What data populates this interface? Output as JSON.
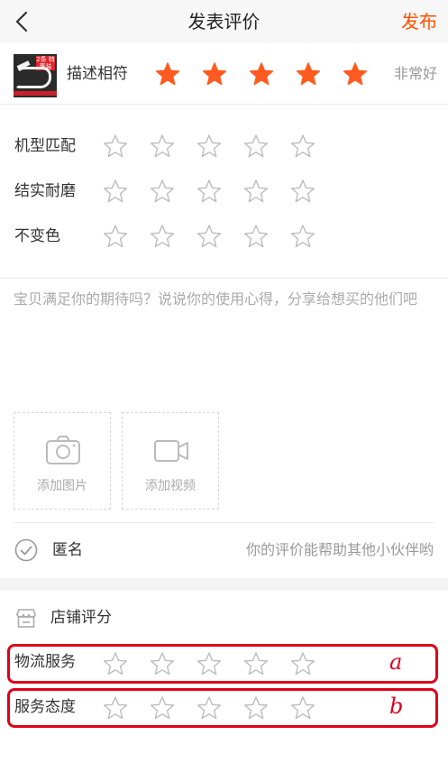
{
  "header": {
    "title": "发表评价",
    "publish_label": "发布"
  },
  "product": {
    "thumb_badge": "2条 特惠装",
    "description_label": "描述相符",
    "description_rating": 5,
    "rating_text": "非常好"
  },
  "aspect_ratings": [
    {
      "label": "机型匹配",
      "rating": 0
    },
    {
      "label": "结实耐磨",
      "rating": 0
    },
    {
      "label": "不变色",
      "rating": 0
    }
  ],
  "review": {
    "placeholder": "宝贝满足你的期待吗？说说你的使用心得，分享给想买的他们吧"
  },
  "media": {
    "add_photo_label": "添加图片",
    "add_video_label": "添加视频"
  },
  "anonymous": {
    "label": "匿名",
    "hint": "你的评价能帮助其他小伙伴哟"
  },
  "store": {
    "title": "店铺评分",
    "ratings": [
      {
        "label": "物流服务",
        "rating": 0,
        "annotation": "a"
      },
      {
        "label": "服务态度",
        "rating": 0,
        "annotation": "b"
      }
    ]
  },
  "colors": {
    "accent": "#ff5000",
    "star_filled": "#ff5a1f",
    "star_empty_stroke": "#bdbdbd",
    "annotation": "#e0001a"
  }
}
